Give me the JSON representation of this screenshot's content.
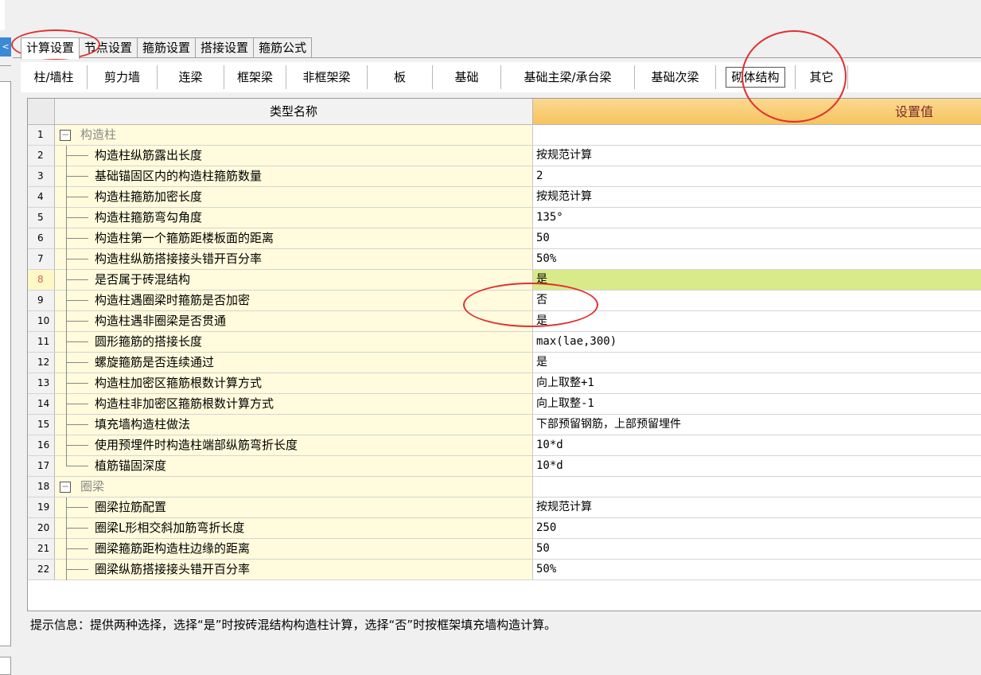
{
  "left_tab": "<",
  "top_tabs": [
    "计算设置",
    "节点设置",
    "箍筋设置",
    "搭接设置",
    "箍筋公式"
  ],
  "categories": [
    "柱/墙柱",
    "剪力墙",
    "连梁",
    "框架梁",
    "非框架梁",
    "板",
    "基础",
    "基础主梁/承台梁",
    "基础次梁",
    "砌体结构",
    "其它"
  ],
  "grid": {
    "col_name": "类型名称",
    "col_value": "设置值",
    "rows": [
      {
        "num": "1",
        "name": "构造柱",
        "value": ""
      },
      {
        "num": "2",
        "name": "构造柱纵筋露出长度",
        "value": "按规范计算"
      },
      {
        "num": "3",
        "name": "基础锚固区内的构造柱箍筋数量",
        "value": "2"
      },
      {
        "num": "4",
        "name": "构造柱箍筋加密长度",
        "value": "按规范计算"
      },
      {
        "num": "5",
        "name": "构造柱箍筋弯勾角度",
        "value": "135°"
      },
      {
        "num": "6",
        "name": "构造柱第一个箍筋距楼板面的距离",
        "value": "50"
      },
      {
        "num": "7",
        "name": "构造柱纵筋搭接接头错开百分率",
        "value": "50%"
      },
      {
        "num": "8",
        "name": "是否属于砖混结构",
        "value": "是"
      },
      {
        "num": "9",
        "name": "构造柱遇圈梁时箍筋是否加密",
        "value": "否"
      },
      {
        "num": "10",
        "name": "构造柱遇非圈梁是否贯通",
        "value": "是"
      },
      {
        "num": "11",
        "name": "圆形箍筋的搭接长度",
        "value": "max(lae,300)"
      },
      {
        "num": "12",
        "name": "螺旋箍筋是否连续通过",
        "value": "是"
      },
      {
        "num": "13",
        "name": "构造柱加密区箍筋根数计算方式",
        "value": "向上取整+1"
      },
      {
        "num": "14",
        "name": "构造柱非加密区箍筋根数计算方式",
        "value": "向上取整-1"
      },
      {
        "num": "15",
        "name": "填充墙构造柱做法",
        "value": "下部预留钢筋，上部预留埋件"
      },
      {
        "num": "16",
        "name": "使用预埋件时构造柱端部纵筋弯折长度",
        "value": "10*d"
      },
      {
        "num": "17",
        "name": "植筋锚固深度",
        "value": "10*d"
      },
      {
        "num": "18",
        "name": "圈梁",
        "value": ""
      },
      {
        "num": "19",
        "name": "圈梁拉筋配置",
        "value": "按规范计算"
      },
      {
        "num": "20",
        "name": "圈梁L形相交斜加筋弯折长度",
        "value": "250"
      },
      {
        "num": "21",
        "name": "圈梁箍筋距构造柱边缘的距离",
        "value": "50"
      },
      {
        "num": "22",
        "name": "圈梁纵筋搭接接头错开百分率",
        "value": "50%"
      }
    ]
  },
  "hint": "提示信息：提供两种选择，选择“是”时按砖混结构构造柱计算，选择“否”时按框架填充墙构造计算。",
  "colors": {
    "annotation": "#e03030",
    "header": "#f6c45e",
    "selected_value": "#d9ea8a"
  }
}
